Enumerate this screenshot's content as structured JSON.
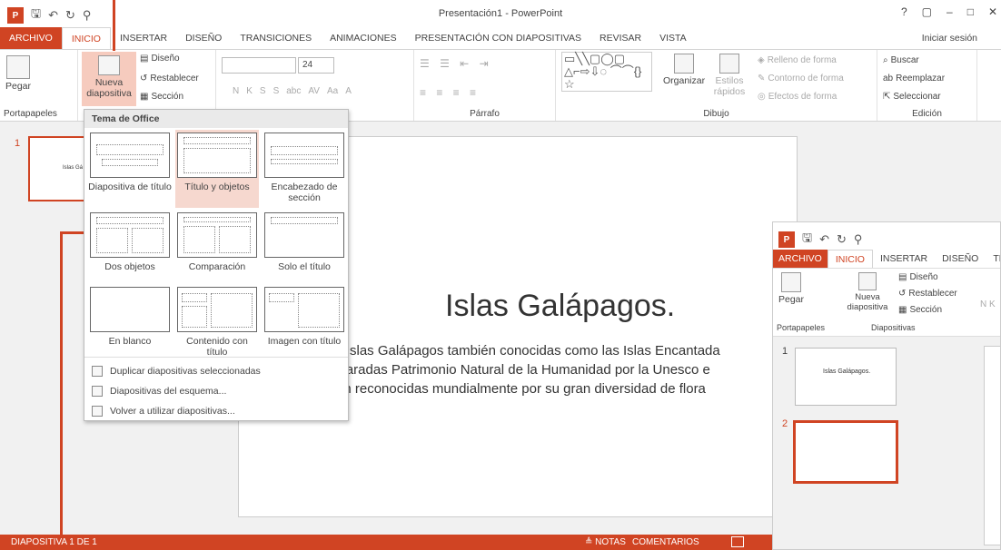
{
  "app": {
    "window_title": "Presentación1 - PowerPoint",
    "logo": "P",
    "qat_icons": [
      "save-icon",
      "undo-icon",
      "redo-icon",
      "customize-icon"
    ],
    "window_controls": [
      "?",
      "▢",
      "–",
      "□",
      "✕"
    ],
    "signin": "Iniciar sesión",
    "brand_color": "#d04423"
  },
  "tabs": [
    {
      "label": "ARCHIVO"
    },
    {
      "label": "INICIO"
    },
    {
      "label": "INSERTAR"
    },
    {
      "label": "DISEÑO"
    },
    {
      "label": "TRANSICIONES"
    },
    {
      "label": "ANIMACIONES"
    },
    {
      "label": "PRESENTACIÓN CON DIAPOSITIVAS"
    },
    {
      "label": "REVISAR"
    },
    {
      "label": "VISTA"
    }
  ],
  "ribbon": {
    "clipboard": {
      "label": "Portapapeles",
      "paste": "Pegar"
    },
    "slides": {
      "new_slide": "Nueva diapositiva",
      "layout": "Diseño",
      "reset": "Restablecer",
      "section": "Sección"
    },
    "font": {
      "size": "24",
      "bold": "N",
      "italic": "K",
      "underline": "S",
      "strike": "S",
      "abc": "abc",
      "spacing": "AV",
      "case": "Aa",
      "color": "A"
    },
    "paragraph": {
      "label": "Párrafo"
    },
    "drawing": {
      "label": "Dibujo",
      "arrange": "Organizar",
      "quick_styles": "Estilos rápidos",
      "fill": "Relleno de forma",
      "outline": "Contorno de forma",
      "effects": "Efectos de forma"
    },
    "editing": {
      "label": "Edición",
      "find": "Buscar",
      "replace": "Reemplazar",
      "select": "Seleccionar"
    }
  },
  "dropdown": {
    "header": "Tema de Office",
    "layouts": [
      {
        "label": "Diapositiva de título"
      },
      {
        "label": "Título y objetos"
      },
      {
        "label": "Encabezado de sección"
      },
      {
        "label": "Dos objetos"
      },
      {
        "label": "Comparación"
      },
      {
        "label": "Solo el título"
      },
      {
        "label": "En blanco"
      },
      {
        "label": "Contenido con título"
      },
      {
        "label": "Imagen con título"
      }
    ],
    "actions": [
      {
        "label": "Duplicar diapositivas seleccionadas"
      },
      {
        "label": "Diapositivas del esquema..."
      },
      {
        "label": "Volver a utilizar diapositivas..."
      }
    ]
  },
  "slide": {
    "number": "1",
    "thumb_text": "Islas Gá",
    "title": "Islas Galápagos.",
    "body_lines": [
      "s islas Galápagos también conocidas como las Islas Encantada",
      "claradas Patrimonio Natural de la Humanidad por la Unesco e",
      "on reconocidas mundialmente por su gran diversidad de flora"
    ]
  },
  "statusbar": {
    "slide_of": "DIAPOSITIVA 1 DE 1",
    "notes": "≜ NOTAS",
    "comments": "COMENTARIOS"
  },
  "inset": {
    "tabs": [
      {
        "label": "ARCHIVO"
      },
      {
        "label": "INICIO"
      },
      {
        "label": "INSERTAR"
      },
      {
        "label": "DISEÑO"
      },
      {
        "label": "TRA"
      }
    ],
    "paste": "Pegar",
    "new_slide": "Nueva diapositiva",
    "layout": "Diseño",
    "reset": "Restablecer",
    "section": "Sección",
    "clipboard_label": "Portapapeles",
    "slides_label": "Diapositivas",
    "font_hint": "N K",
    "thumb1_number": "1",
    "thumb1_text": "Islas Galápagos.",
    "thumb2_number": "2"
  }
}
